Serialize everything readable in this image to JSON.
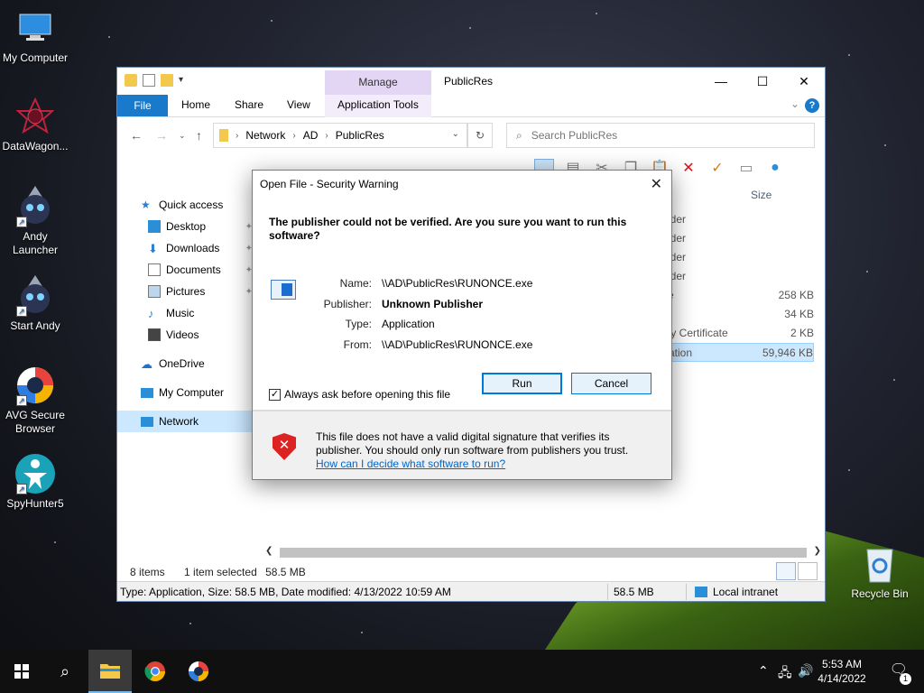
{
  "desktop": {
    "icons": [
      {
        "label": "My Computer"
      },
      {
        "label": "DataWagon..."
      },
      {
        "label": "Andy Launcher"
      },
      {
        "label": "Start Andy"
      },
      {
        "label": "AVG Secure Browser"
      },
      {
        "label": "SpyHunter5"
      },
      {
        "label": "Recycle Bin"
      }
    ]
  },
  "explorer": {
    "title": "PublicRes",
    "contextual_tab": "Manage",
    "tabs": [
      "File",
      "Home",
      "Share",
      "View",
      "Application Tools"
    ],
    "breadcrumb": [
      "Network",
      "AD",
      "PublicRes"
    ],
    "search_placeholder": "Search PublicRes",
    "nav": [
      {
        "label": "Quick access"
      },
      {
        "label": "Desktop"
      },
      {
        "label": "Downloads"
      },
      {
        "label": "Documents"
      },
      {
        "label": "Pictures"
      },
      {
        "label": "Music"
      },
      {
        "label": "Videos"
      },
      {
        "label": "OneDrive"
      },
      {
        "label": "My Computer"
      },
      {
        "label": "Network"
      }
    ],
    "column_size": "Size",
    "rows": [
      {
        "name": "lder",
        "size": ""
      },
      {
        "name": "lder",
        "size": ""
      },
      {
        "name": "lder",
        "size": ""
      },
      {
        "name": "lder",
        "size": ""
      },
      {
        "name": "e",
        "size": "258 KB"
      },
      {
        "name": "",
        "size": "34 KB"
      },
      {
        "name": "ty Certificate",
        "size": "2 KB"
      },
      {
        "name": "ation",
        "size": "59,946 KB"
      }
    ],
    "status": {
      "items": "8 items",
      "selected": "1 item selected",
      "selected_size": "58.5 MB"
    },
    "details_bar": {
      "text": "Type: Application, Size: 58.5 MB, Date modified: 4/13/2022 10:59 AM",
      "size": "58.5 MB",
      "zone": "Local intranet"
    }
  },
  "dialog": {
    "title": "Open File - Security Warning",
    "question": "The publisher could not be verified.  Are you sure you want to run this software?",
    "fields": [
      {
        "key": "Name:",
        "value": "\\\\AD\\PublicRes\\RUNONCE.exe",
        "bold": false
      },
      {
        "key": "Publisher:",
        "value": "Unknown Publisher",
        "bold": true
      },
      {
        "key": "Type:",
        "value": "Application",
        "bold": false
      },
      {
        "key": "From:",
        "value": "\\\\AD\\PublicRes\\RUNONCE.exe",
        "bold": false
      }
    ],
    "run_label": "Run",
    "cancel_label": "Cancel",
    "checkbox_label": "Always ask before opening this file",
    "checkbox_checked": true,
    "footer_text": "This file does not have a valid digital signature that verifies its publisher.  You should only run software from publishers you trust.",
    "footer_link": "How can I decide what software to run?"
  },
  "taskbar": {
    "time": "5:53 AM",
    "date": "4/14/2022",
    "notification_count": "1"
  }
}
